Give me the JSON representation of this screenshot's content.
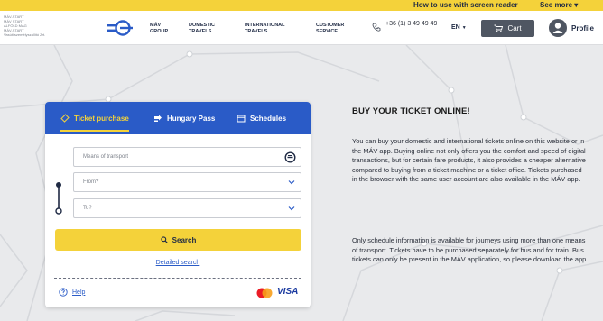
{
  "a11y_bar": {
    "screen_reader_link": "How to use with screen reader",
    "see_more": "See more ▾"
  },
  "header": {
    "tiny_text": [
      "MÁV-START",
      "MÁV START",
      "ALFÖLD MAG",
      "MÁV-START",
      "Vasúti személyszállító Zrt."
    ],
    "nav": [
      {
        "line1": "MÁV",
        "line2": "GROUP"
      },
      {
        "line1": "DOMESTIC",
        "line2": "TRAVELS"
      },
      {
        "line1": "INTERNATIONAL",
        "line2": "TRAVELS"
      },
      {
        "line1": "CUSTOMER",
        "line2": "SERVICE"
      }
    ],
    "phone": "+36 (1) 3 49 49 49",
    "language": "EN",
    "cart_label": "Cart",
    "profile_label": "Profile"
  },
  "widget": {
    "tabs": [
      {
        "label": "Ticket purchase",
        "icon": "ticket-icon"
      },
      {
        "label": "Hungary Pass",
        "icon": "pass-icon"
      },
      {
        "label": "Schedules",
        "icon": "calendar-icon"
      }
    ],
    "means_placeholder": "Means of transport",
    "from_placeholder": "From?",
    "to_placeholder": "To?",
    "search_label": "Search",
    "detailed_search": "Detailed search",
    "help_label": "Help",
    "visa_label": "VISA"
  },
  "content": {
    "heading": "BUY YOUR TICKET ONLINE!",
    "paragraph1": "You can buy your domestic and international tickets online on this website or in the MÁV app. Buying online not only offers you the comfort and speed of digital transactions, but for certain fare products, it also provides a cheaper alternative compared to buying from a ticket machine or a ticket office. Tickets purchased in the browser with the same user account are also available in the MÁV app.",
    "paragraph2": "Only schedule information is available for journeys using more than one means of transport. Tickets have to be purchased separately for bus and for train. Bus tickets can only be present in the MÁV application, so please download the app."
  },
  "colors": {
    "accent_yellow": "#f4d23a",
    "brand_blue": "#2a5bc7",
    "cart_gray": "#4f5662"
  }
}
